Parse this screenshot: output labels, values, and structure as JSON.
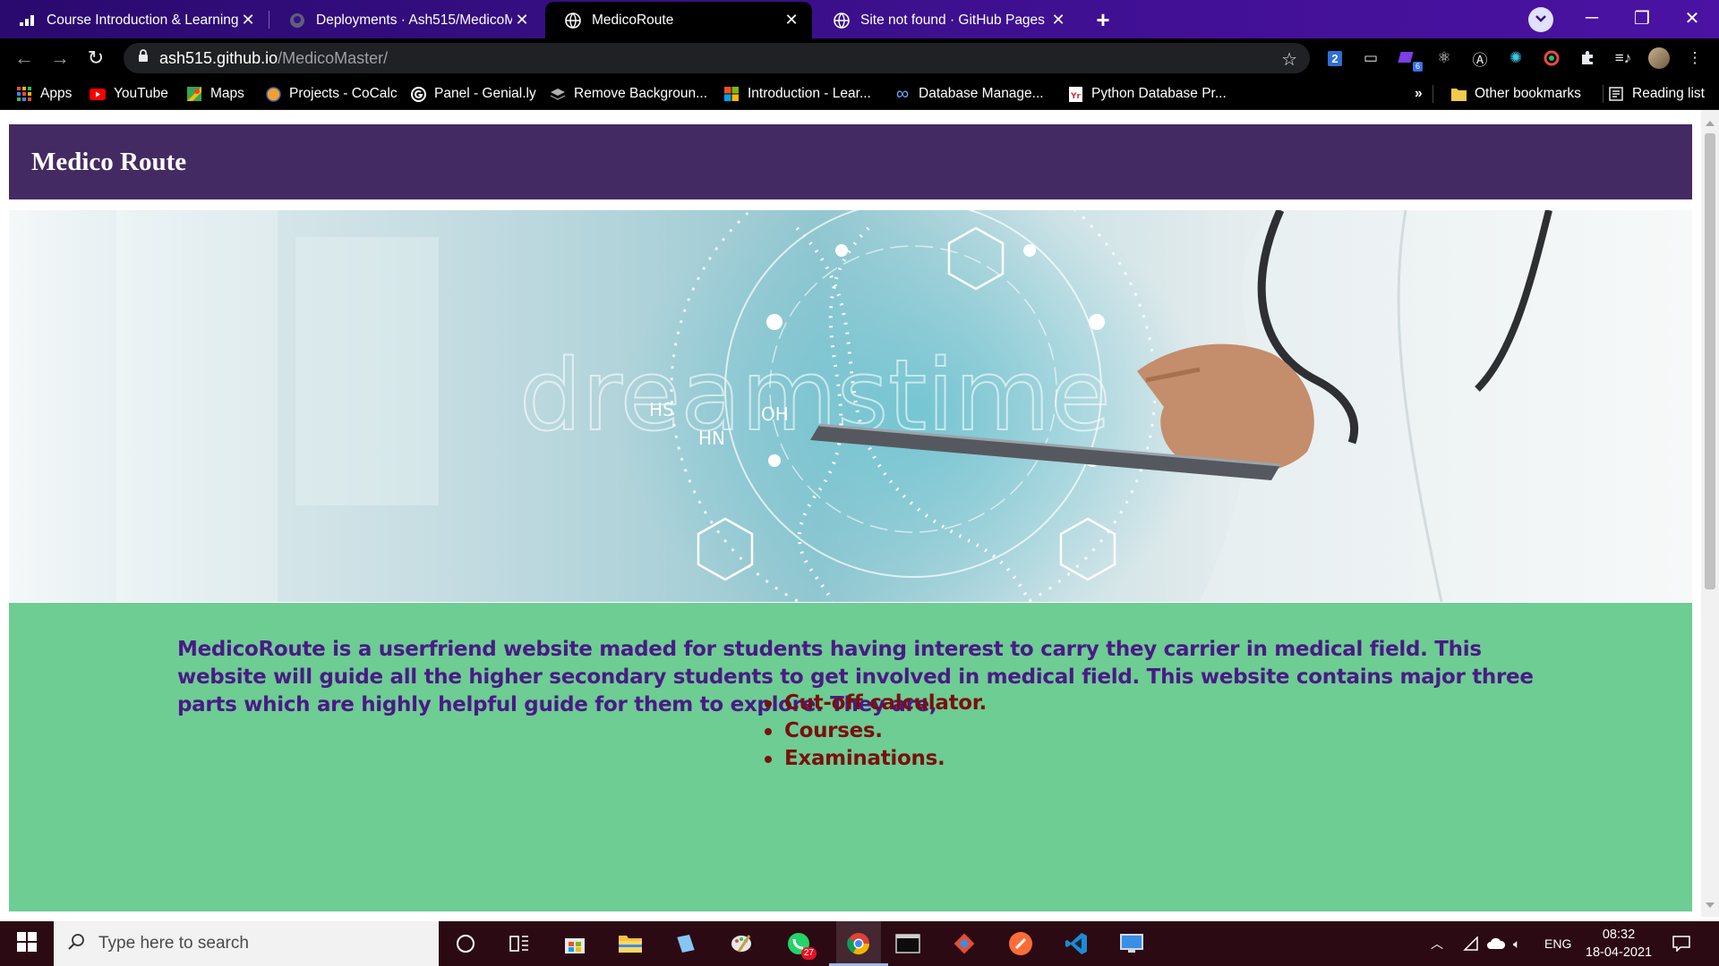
{
  "browser": {
    "tabs": [
      {
        "title": "Course Introduction & Learning I",
        "active": false,
        "icon": "coursera-icon"
      },
      {
        "title": "Deployments · Ash515/MedicoM",
        "active": false,
        "icon": "github-icon"
      },
      {
        "title": "MedicoRoute",
        "active": true,
        "icon": "globe-icon"
      },
      {
        "title": "Site not found · GitHub Pages",
        "active": false,
        "icon": "globe-icon"
      }
    ],
    "url": {
      "host": "ash515.github.io",
      "path": "/MedicoMaster/"
    },
    "extension_badges": {
      "first": "2",
      "purple": "6"
    },
    "bookmarks": [
      {
        "label": "Apps",
        "icon": "apps-grid-icon"
      },
      {
        "label": "YouTube",
        "icon": "youtube-icon"
      },
      {
        "label": "Maps",
        "icon": "maps-icon"
      },
      {
        "label": "Projects - CoCalc",
        "icon": "cocalc-icon"
      },
      {
        "label": "Panel - Genial.ly",
        "icon": "genially-icon"
      },
      {
        "label": "Remove Backgroun...",
        "icon": "removebg-icon"
      },
      {
        "label": "Introduction - Lear...",
        "icon": "microsoft-icon"
      },
      {
        "label": "Database Manage...",
        "icon": "infinity-icon"
      },
      {
        "label": "Python Database Pr...",
        "icon": "pdf-icon"
      }
    ],
    "other_bookmarks": "Other bookmarks",
    "reading_list": "Reading list",
    "overflow": "»"
  },
  "page": {
    "site_title": "Medico Route",
    "hero_watermark": "dreamstime",
    "hero_labels": {
      "hs": "HS",
      "hn": "HN",
      "oh": "OH"
    },
    "intro_text": "MedicoRoute is a userfriend website maded for students having interest to carry they carrier in medical field. This website will guide all the higher secondary students to get involved in medical field. This website contains major three parts which are highly helpful guide for them to explore. They are,",
    "parts": [
      "Cut-off calculator.",
      "Courses.",
      "Examinations."
    ],
    "colors": {
      "header_bg": "#442a62",
      "intro_bg": "#6dcd93",
      "intro_text": "#4a1a86",
      "list_text": "#7a0f0f"
    }
  },
  "taskbar": {
    "search_placeholder": "Type here to search",
    "whatsapp_badge": "27",
    "language": "ENG",
    "time": "08:32",
    "date": "18-04-2021"
  }
}
